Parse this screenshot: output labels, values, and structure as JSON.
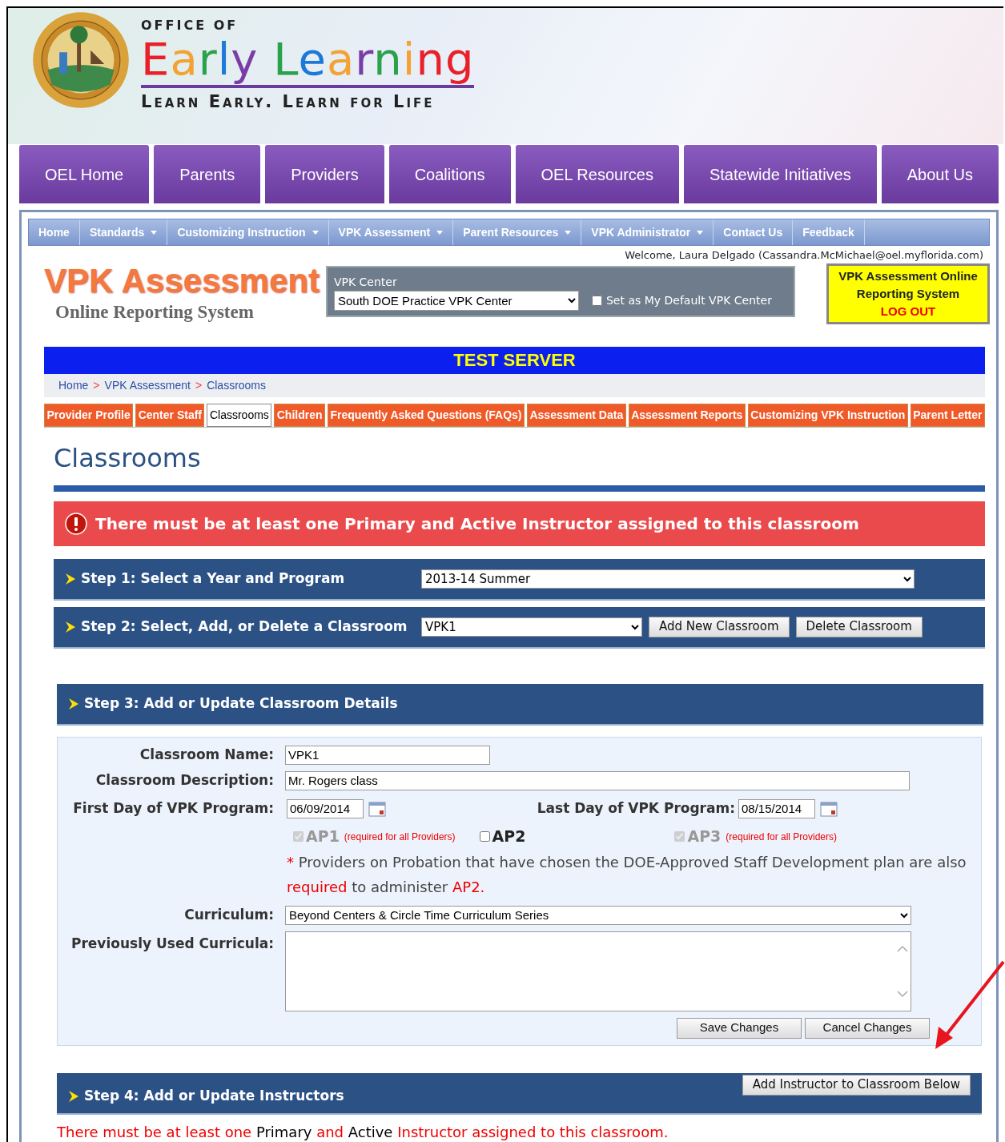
{
  "header": {
    "overline": "OFFICE OF",
    "title": "Early Learning",
    "tagline": "Learn Early. Learn for Life"
  },
  "main_nav": [
    {
      "label": "OEL Home"
    },
    {
      "label": "Parents"
    },
    {
      "label": "Providers"
    },
    {
      "label": "Coalitions"
    },
    {
      "label": "OEL Resources"
    },
    {
      "label": "Statewide Initiatives"
    },
    {
      "label": "About Us"
    }
  ],
  "sub_nav": [
    {
      "label": "Home",
      "dropdown": false
    },
    {
      "label": "Standards",
      "dropdown": true
    },
    {
      "label": "Customizing Instruction",
      "dropdown": true
    },
    {
      "label": "VPK Assessment",
      "dropdown": true
    },
    {
      "label": "Parent Resources",
      "dropdown": true
    },
    {
      "label": "VPK Administrator",
      "dropdown": true
    },
    {
      "label": "Contact Us",
      "dropdown": false
    },
    {
      "label": "Feedback",
      "dropdown": false
    }
  ],
  "welcome": "Welcome, Laura Delgado (Cassandra.McMichael@oel.myflorida.com)",
  "app_logo": {
    "title": "VPK Assessment",
    "subtitle": "Online Reporting System"
  },
  "vpk_center": {
    "label": "VPK Center",
    "value": "South DOE Practice VPK Center",
    "default_checkbox": {
      "label": "Set as My Default VPK Center",
      "checked": false
    }
  },
  "logout_box": {
    "title": "VPK Assessment Online Reporting System",
    "link": "LOG OUT"
  },
  "banner": "TEST SERVER",
  "breadcrumb": {
    "separator": ">",
    "items": [
      "Home",
      "VPK Assessment",
      "Classrooms"
    ]
  },
  "page_tabs": [
    {
      "label": "Provider Profile",
      "selected": false
    },
    {
      "label": "Center Staff",
      "selected": false
    },
    {
      "label": "Classrooms",
      "selected": true
    },
    {
      "label": "Children",
      "selected": false
    },
    {
      "label": "Frequently Asked Questions (FAQs)",
      "selected": false
    },
    {
      "label": "Assessment Data",
      "selected": false
    },
    {
      "label": "Assessment Reports",
      "selected": false
    },
    {
      "label": "Customizing VPK Instruction",
      "selected": false
    },
    {
      "label": "Parent Letter",
      "selected": false
    }
  ],
  "page_title": "Classrooms",
  "error": "There must be at least one Primary and Active Instructor assigned to this classroom",
  "step1": {
    "title": "Step 1: Select a Year and Program",
    "value": "2013-14 Summer"
  },
  "step2": {
    "title": "Step 2: Select, Add, or Delete a Classroom",
    "value": "VPK1",
    "buttons": [
      "Add New Classroom",
      "Delete Classroom"
    ]
  },
  "step3": {
    "title": "Step 3: Add or Update Classroom Details"
  },
  "form": {
    "name_label": "Classroom Name:",
    "name_value": "VPK1",
    "description_label": "Classroom Description:",
    "description_value": "Mr. Rogers class",
    "first_day_label": "First Day of VPK Program:",
    "first_day_value": "06/09/2014",
    "last_day_label": "Last Day of VPK Program:",
    "last_day_value": "08/15/2014",
    "assessments": [
      {
        "label": "AP1",
        "checked": true,
        "disabled": true,
        "note": "(required for all Providers)"
      },
      {
        "label": "AP2",
        "checked": false,
        "disabled": false
      },
      {
        "label": "AP3",
        "checked": true,
        "disabled": true,
        "note": "(required for all Providers)"
      }
    ],
    "note_parts": [
      {
        "text": "* ",
        "highlight": true
      },
      {
        "text": "Providers on Probation that have chosen the DOE-Approved Staff Development plan are also ",
        "highlight": false
      },
      {
        "text": "required",
        "highlight": true
      },
      {
        "text": " to administer ",
        "highlight": false
      },
      {
        "text": "AP2.",
        "highlight": true
      }
    ],
    "curriculum_label": "Curriculum:",
    "curriculum_value": "Beyond Centers & Circle Time Curriculum Series",
    "previous_label": "Previously Used Curricula:",
    "buttons": [
      "Save Changes",
      "Cancel Changes"
    ]
  },
  "step4": {
    "title": "Step 4: Add or Update Instructors",
    "button": "Add Instructor to Classroom Below"
  },
  "notice_parts": [
    {
      "text": "There must be at least one ",
      "highlight": true
    },
    {
      "text": "Primary",
      "highlight": false
    },
    {
      "text": " and ",
      "highlight": true
    },
    {
      "text": "Active",
      "highlight": false
    },
    {
      "text": " Instructor assigned to this classroom.",
      "highlight": true
    }
  ]
}
